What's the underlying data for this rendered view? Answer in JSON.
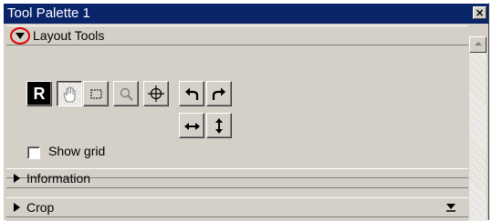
{
  "window": {
    "title": "Tool Palette 1",
    "close_icon": "close-icon"
  },
  "sections": {
    "layout_tools": {
      "label": "Layout Tools",
      "expanded": true
    },
    "information": {
      "label": "Information",
      "expanded": false
    },
    "crop": {
      "label": "Crop",
      "expanded": false
    }
  },
  "tools": {
    "r_label": "R",
    "hand_icon": "hand-icon",
    "marquee_icon": "marquee-select-icon",
    "zoom_icon": "magnifier-icon",
    "crosshair_icon": "crosshair-icon",
    "rotate_left_icon": "rotate-left-icon",
    "rotate_right_icon": "rotate-right-icon",
    "flip_horizontal_icon": "flip-horizontal-icon",
    "flip_vertical_icon": "flip-vertical-icon"
  },
  "options": {
    "show_grid_label": "Show grid",
    "show_grid_checked": false
  },
  "colors": {
    "title_bar": "#0a246a",
    "highlight_circle": "#e00000",
    "panel_bg": "#d4d0c8"
  }
}
